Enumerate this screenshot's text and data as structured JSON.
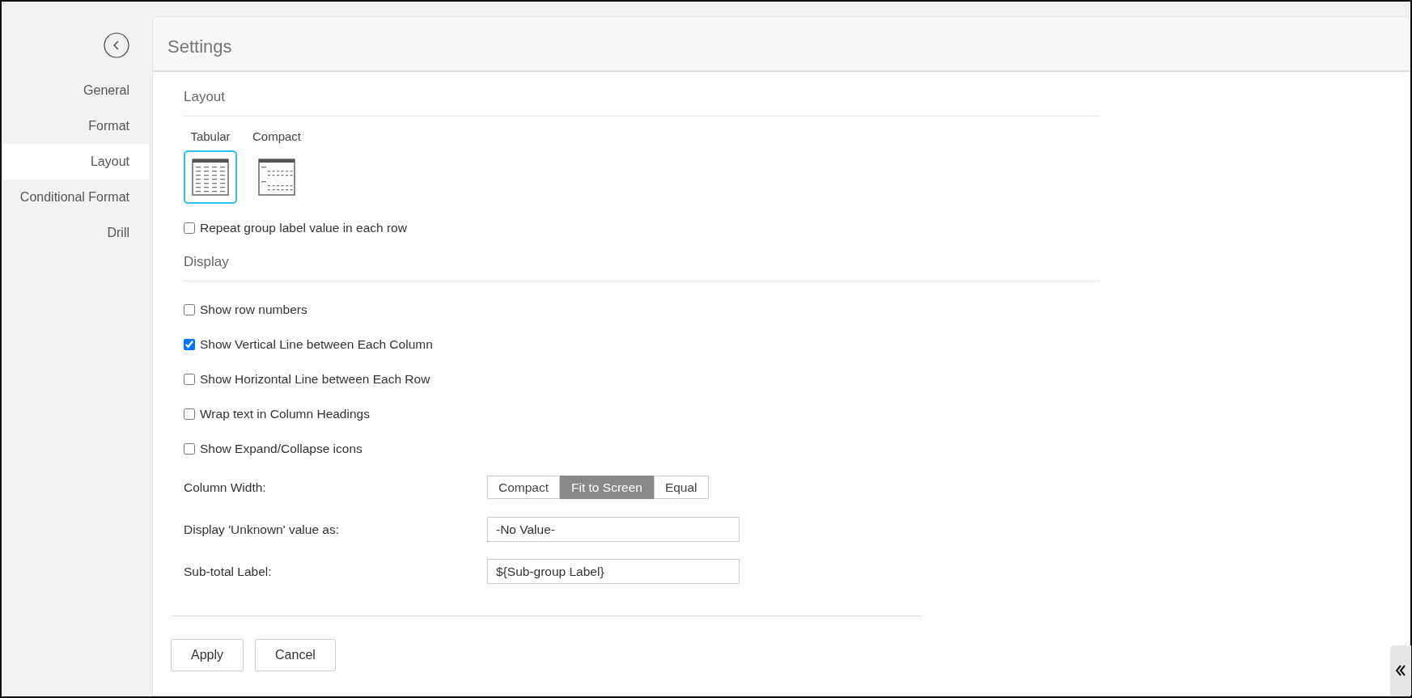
{
  "sidebar": {
    "items": [
      {
        "label": "General",
        "selected": false
      },
      {
        "label": "Format",
        "selected": false
      },
      {
        "label": "Layout",
        "selected": true
      },
      {
        "label": "Conditional Format",
        "selected": false
      },
      {
        "label": "Drill",
        "selected": false
      }
    ]
  },
  "panel": {
    "title": "Settings",
    "layout_section": {
      "heading": "Layout",
      "options": [
        {
          "label": "Tabular",
          "kind": "tabular",
          "selected": true
        },
        {
          "label": "Compact",
          "kind": "compact",
          "selected": false
        }
      ],
      "checkboxes": [
        {
          "label": "Repeat group label value in each row",
          "checked": false
        }
      ]
    },
    "display_section": {
      "heading": "Display",
      "checkboxes": [
        {
          "label": "Show row numbers",
          "checked": false
        },
        {
          "label": "Show Vertical Line between Each Column",
          "checked": true
        },
        {
          "label": "Show Horizontal Line between Each Row",
          "checked": false
        },
        {
          "label": "Wrap text in Column Headings",
          "checked": false
        },
        {
          "label": "Show Expand/Collapse icons",
          "checked": false
        }
      ],
      "column_width": {
        "label": "Column Width:",
        "options": [
          {
            "label": "Compact",
            "selected": false
          },
          {
            "label": "Fit to Screen",
            "selected": true
          },
          {
            "label": "Equal",
            "selected": false
          }
        ]
      },
      "fields": [
        {
          "label": "Display 'Unknown' value as:",
          "value": "-No Value-"
        },
        {
          "label": "Sub-total Label:",
          "value": "${Sub-group Label}"
        }
      ]
    },
    "buttons": [
      "Apply",
      "Cancel"
    ]
  }
}
